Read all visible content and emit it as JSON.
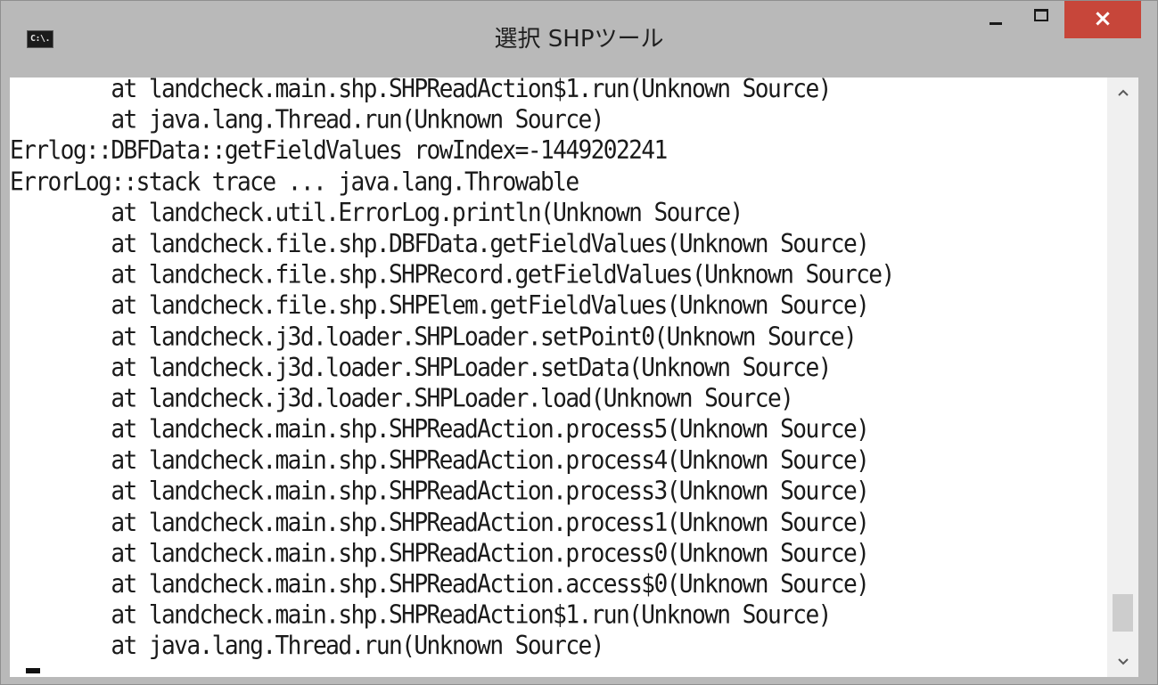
{
  "window": {
    "title": "選択 SHPツール",
    "icon_label": "C:\\.",
    "icon_name": "command-prompt-icon",
    "close_symbol": "×",
    "colors": {
      "titlebar": "#b9b9b9",
      "close_button": "#c7463a",
      "console_background": "#ffffff",
      "console_text": "#1a1a1a",
      "scrollbar_track": "#f0f0f0",
      "scrollbar_thumb": "#cdcdcd"
    }
  },
  "console": {
    "lines": [
      "        at landcheck.main.shp.SHPReadAction$1.run(Unknown Source)",
      "        at java.lang.Thread.run(Unknown Source)",
      "Errlog::DBFData::getFieldValues rowIndex=-1449202241",
      "ErrorLog::stack trace ... java.lang.Throwable",
      "        at landcheck.util.ErrorLog.println(Unknown Source)",
      "        at landcheck.file.shp.DBFData.getFieldValues(Unknown Source)",
      "        at landcheck.file.shp.SHPRecord.getFieldValues(Unknown Source)",
      "        at landcheck.file.shp.SHPElem.getFieldValues(Unknown Source)",
      "        at landcheck.j3d.loader.SHPLoader.setPoint0(Unknown Source)",
      "        at landcheck.j3d.loader.SHPLoader.setData(Unknown Source)",
      "        at landcheck.j3d.loader.SHPLoader.load(Unknown Source)",
      "        at landcheck.main.shp.SHPReadAction.process5(Unknown Source)",
      "        at landcheck.main.shp.SHPReadAction.process4(Unknown Source)",
      "        at landcheck.main.shp.SHPReadAction.process3(Unknown Source)",
      "        at landcheck.main.shp.SHPReadAction.process1(Unknown Source)",
      "        at landcheck.main.shp.SHPReadAction.process0(Unknown Source)",
      "        at landcheck.main.shp.SHPReadAction.access$0(Unknown Source)",
      "        at landcheck.main.shp.SHPReadAction$1.run(Unknown Source)",
      "        at java.lang.Thread.run(Unknown Source)",
      ""
    ]
  },
  "scrollbar": {
    "scroll_position": 0.97
  }
}
